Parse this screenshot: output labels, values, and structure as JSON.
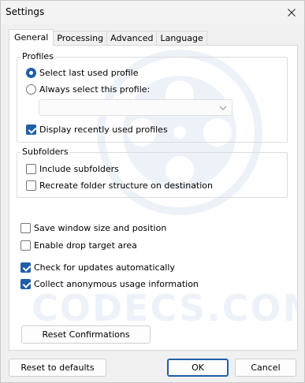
{
  "window": {
    "title": "Settings"
  },
  "tabs": [
    {
      "label": "General",
      "active": true
    },
    {
      "label": "Processing",
      "active": false
    },
    {
      "label": "Advanced",
      "active": false
    },
    {
      "label": "Language",
      "active": false
    }
  ],
  "profiles": {
    "title": "Profiles",
    "select_last_label": "Select last used profile",
    "select_last_checked": true,
    "always_select_label": "Always select this profile:",
    "always_select_checked": false,
    "profile_combo_value": "",
    "display_recent_label": "Display recently used profiles",
    "display_recent_checked": true
  },
  "subfolders": {
    "title": "Subfolders",
    "include_label": "Include subfolders",
    "include_checked": false,
    "recreate_label": "Recreate folder structure on destination",
    "recreate_checked": false
  },
  "options": {
    "save_window_label": "Save window size and position",
    "save_window_checked": false,
    "drop_target_label": "Enable drop target area",
    "drop_target_checked": false,
    "check_updates_label": "Check for updates automatically",
    "check_updates_checked": true,
    "collect_usage_label": "Collect anonymous usage information",
    "collect_usage_checked": true
  },
  "watermark": {
    "text": "CODECS.COM"
  },
  "buttons": {
    "reset_confirmations": "Reset Confirmations",
    "reset_defaults": "Reset to defaults",
    "ok": "OK",
    "cancel": "Cancel"
  },
  "colors": {
    "accent": "#1f5fa8",
    "watermark": "#2a6ab8"
  }
}
